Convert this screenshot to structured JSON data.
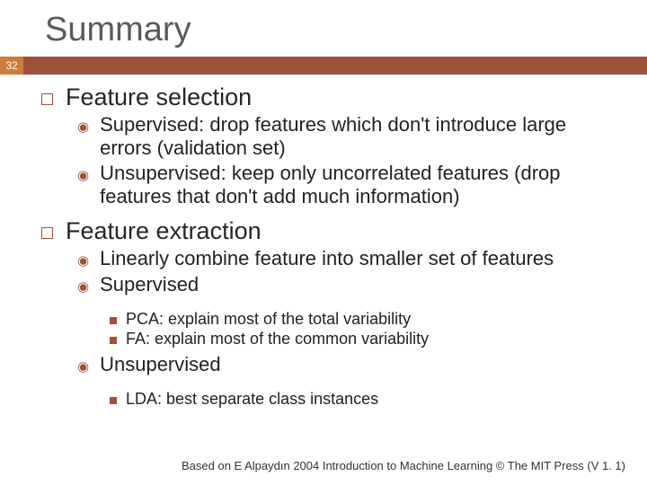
{
  "slide": {
    "title": "Summary",
    "page_number": "32",
    "footer": "Based on E Alpaydın 2004 Introduction to Machine Learning © The MIT Press (V 1. 1)"
  },
  "items": [
    {
      "label": "Feature selection",
      "sub": [
        {
          "text": "Supervised: drop features which don't introduce large errors (validation set)"
        },
        {
          "text": "Unsupervised: keep only uncorrelated features (drop features that don't add much information)"
        }
      ]
    },
    {
      "label": "Feature extraction",
      "sub": [
        {
          "text": "Linearly combine feature into smaller set of features"
        },
        {
          "text": "Supervised",
          "sub": [
            {
              "text": "PCA: explain most of the total variability"
            },
            {
              "text": "FA: explain most of the common variability"
            }
          ]
        },
        {
          "text": "Unsupervised",
          "sub": [
            {
              "text": "LDA: best separate class instances"
            }
          ]
        }
      ]
    }
  ]
}
